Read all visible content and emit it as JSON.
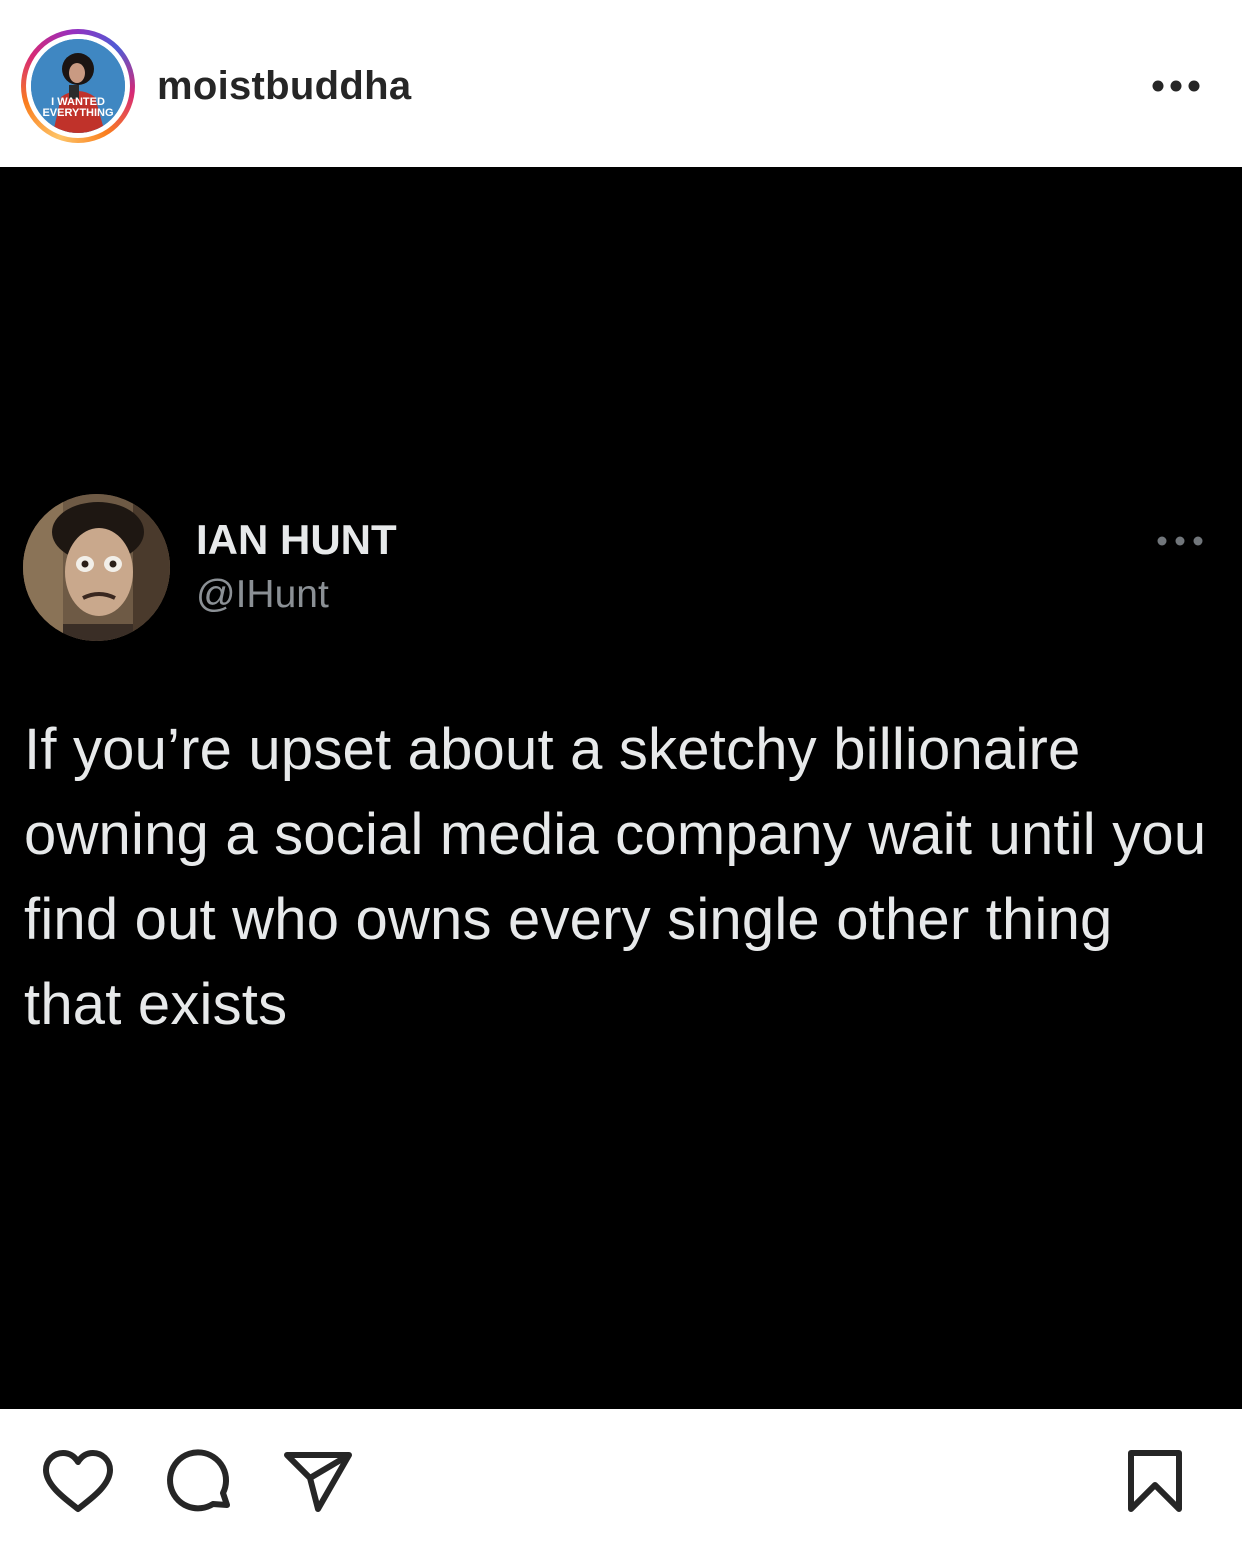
{
  "post": {
    "username": "moistbuddha",
    "avatar_icon": "profile-picture-icon",
    "avatar_text_line1": "I WANTED",
    "avatar_text_line2": "EVERYTHING",
    "more_icon": "more-horizontal-icon"
  },
  "tweet": {
    "display_name": "IAN HUNT",
    "handle": "@IHunt",
    "text": "If you’re upset about a sketchy billionaire owning a social media company wait until you find out who owns every single other thing that exists",
    "more_icon": "more-horizontal-icon",
    "avatar_icon": "profile-picture-icon"
  },
  "actions": {
    "like_icon": "heart-icon",
    "comment_icon": "comment-icon",
    "share_icon": "send-icon",
    "save_icon": "bookmark-icon"
  },
  "colors": {
    "text_primary": "#262626",
    "media_background": "#000000",
    "tweet_text": "#e7e9ea",
    "tweet_handle": "#8b9095",
    "story_ring_start": "#fdc468",
    "story_ring_mid": "#d62976",
    "story_ring_end": "#4f5bd5"
  }
}
